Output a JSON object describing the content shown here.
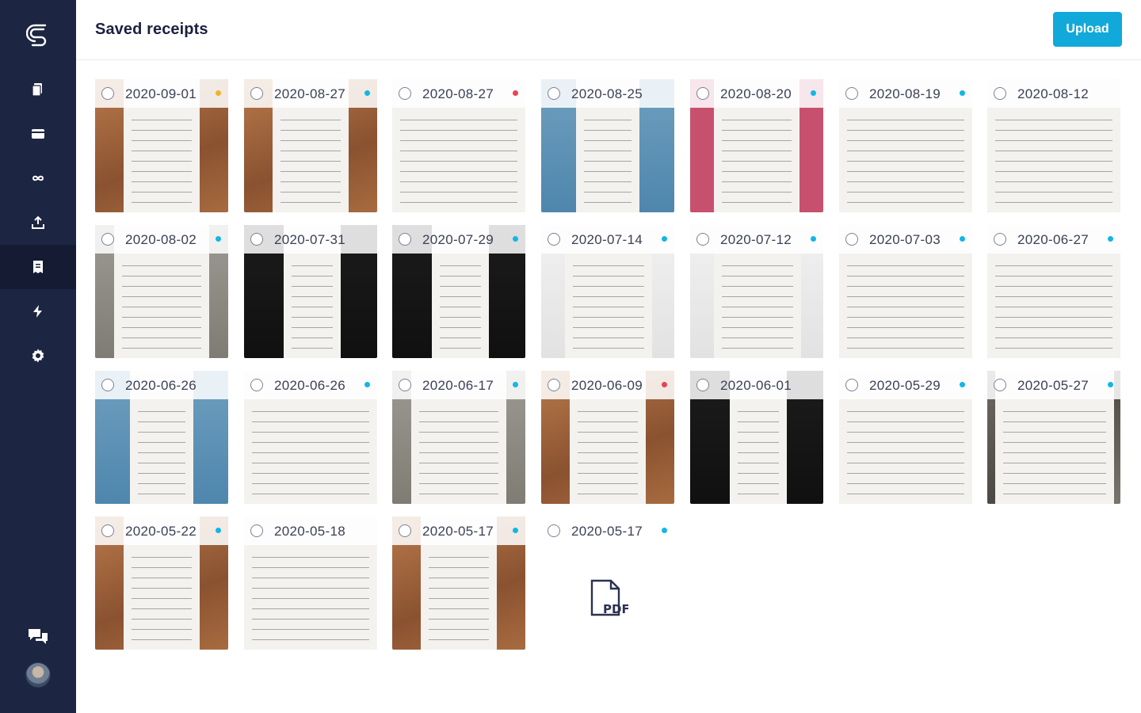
{
  "header": {
    "title": "Saved receipts",
    "upload_label": "Upload"
  },
  "sidebar": {
    "items": [
      {
        "name": "documents-icon",
        "active": false
      },
      {
        "name": "card-icon",
        "active": false
      },
      {
        "name": "infinity-icon",
        "active": false
      },
      {
        "name": "export-icon",
        "active": false
      },
      {
        "name": "receipt-icon",
        "active": true
      },
      {
        "name": "lightning-icon",
        "active": false
      },
      {
        "name": "gear-icon",
        "active": false
      }
    ]
  },
  "colors": {
    "orange": "#f2b32c",
    "cyan": "#11b7e6",
    "red": "#e64455",
    "accent": "#11a9d9"
  },
  "receipts": [
    {
      "date": "2020-09-01",
      "status": "orange",
      "bg": "wood"
    },
    {
      "date": "2020-08-27",
      "status": "cyan",
      "bg": "wood"
    },
    {
      "date": "2020-08-27",
      "status": "red",
      "bg": "paper"
    },
    {
      "date": "2020-08-25",
      "status": "",
      "bg": "blue"
    },
    {
      "date": "2020-08-20",
      "status": "cyan",
      "bg": "pink"
    },
    {
      "date": "2020-08-19",
      "status": "cyan",
      "bg": "paper"
    },
    {
      "date": "2020-08-12",
      "status": "",
      "bg": "gold"
    },
    {
      "date": "2020-08-02",
      "status": "cyan",
      "bg": "gray"
    },
    {
      "date": "2020-07-31",
      "status": "",
      "bg": "dark"
    },
    {
      "date": "2020-07-29",
      "status": "cyan",
      "bg": "dark"
    },
    {
      "date": "2020-07-14",
      "status": "cyan",
      "bg": "light"
    },
    {
      "date": "2020-07-12",
      "status": "cyan",
      "bg": "light"
    },
    {
      "date": "2020-07-03",
      "status": "cyan",
      "bg": "gold"
    },
    {
      "date": "2020-06-27",
      "status": "cyan",
      "bg": "bluepaper"
    },
    {
      "date": "2020-06-26",
      "status": "",
      "bg": "blue"
    },
    {
      "date": "2020-06-26",
      "status": "cyan",
      "bg": "paper"
    },
    {
      "date": "2020-06-17",
      "status": "cyan",
      "bg": "gray"
    },
    {
      "date": "2020-06-09",
      "status": "red",
      "bg": "wood"
    },
    {
      "date": "2020-06-01",
      "status": "",
      "bg": "dark"
    },
    {
      "date": "2020-05-29",
      "status": "cyan",
      "bg": "paper"
    },
    {
      "date": "2020-05-27",
      "status": "cyan",
      "bg": "crumpled"
    },
    {
      "date": "2020-05-22",
      "status": "cyan",
      "bg": "wood"
    },
    {
      "date": "2020-05-18",
      "status": "",
      "bg": "paper"
    },
    {
      "date": "2020-05-17",
      "status": "cyan",
      "bg": "wood"
    },
    {
      "date": "2020-05-17",
      "status": "cyan",
      "bg": "pdf"
    }
  ]
}
